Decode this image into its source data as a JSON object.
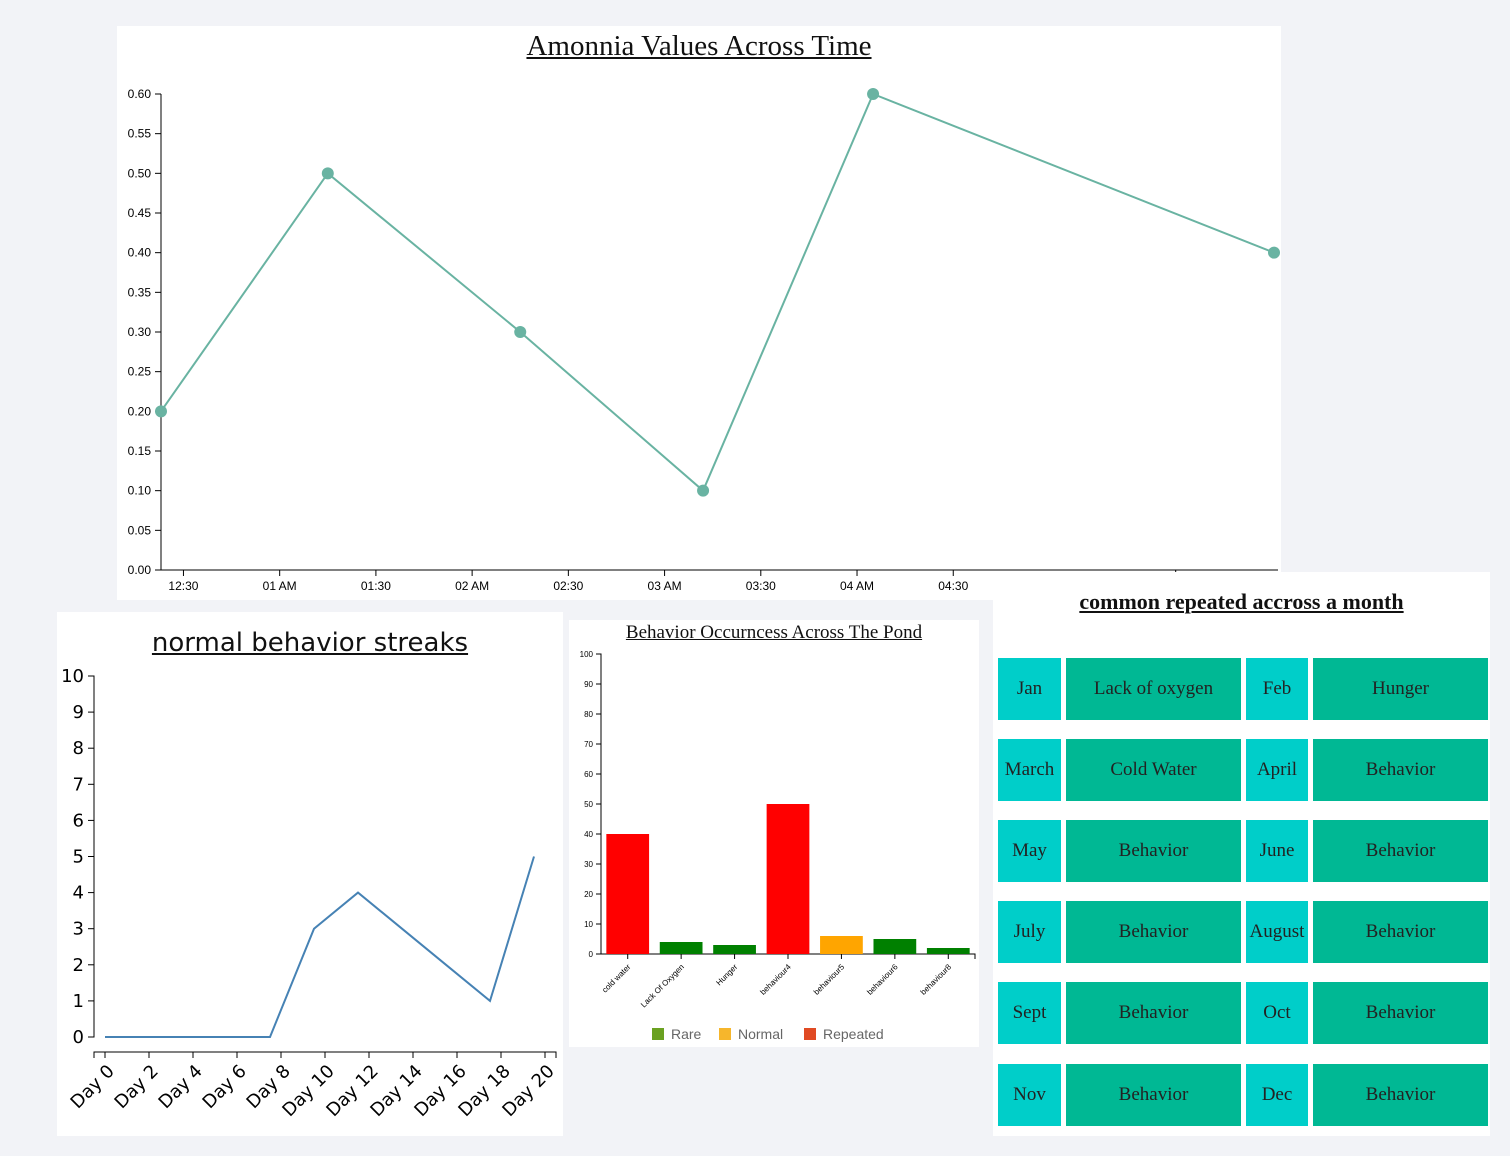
{
  "colors": {
    "page_bg": "#f2f3f7",
    "ammonia_line": "#69b3a2",
    "streak_line": "#4682b4",
    "rare": "#008000",
    "normal": "#ffa500",
    "repeated": "#ff0000",
    "legend_rare": "#6aa121",
    "legend_normal": "#f6b62c",
    "legend_repeated": "#e04a23",
    "month_cell": "#00cec9",
    "behavior_cell": "#00b894"
  },
  "chart_data": [
    {
      "type": "line",
      "title": "Amonnia Values Across Time",
      "x_ticks": [
        "12:30",
        "01 AM",
        "01:30",
        "02 AM",
        "02:30",
        "03 AM",
        "03:30",
        "04 AM",
        "04:30"
      ],
      "x_ticks_minutes": [
        750,
        780,
        810,
        840,
        870,
        900,
        930,
        960,
        990
      ],
      "xlim_minutes": [
        743,
        1090
      ],
      "x_minutes": [
        743,
        795,
        855,
        912,
        965,
        1090
      ],
      "values": [
        0.2,
        0.5,
        0.3,
        0.1,
        0.6,
        0.4
      ],
      "ylim": [
        0,
        0.6
      ],
      "y_ticks": [
        "0.00",
        "0.05",
        "0.10",
        "0.15",
        "0.20",
        "0.25",
        "0.30",
        "0.35",
        "0.40",
        "0.45",
        "0.50",
        "0.55",
        "0.60"
      ],
      "grid": false,
      "markers": true
    },
    {
      "type": "line",
      "title": "normal behavior streaks",
      "categories": [
        "Day 0",
        "Day 2",
        "Day 4",
        "Day 6",
        "Day 8",
        "Day 10",
        "Day 12",
        "Day 14",
        "Day 16",
        "Day 18",
        "Day 20"
      ],
      "x": [
        0,
        2,
        4,
        6,
        7.5,
        9.5,
        11.5,
        13.5,
        15.5,
        17.5,
        19.5
      ],
      "values": [
        0,
        0,
        0,
        0,
        0,
        3,
        4,
        3,
        2,
        1,
        5
      ],
      "xlim": [
        -0.5,
        20.5
      ],
      "ylim": [
        0,
        10
      ],
      "y_ticks": [
        "0",
        "1",
        "2",
        "3",
        "4",
        "5",
        "6",
        "7",
        "8",
        "9",
        "10"
      ],
      "grid": false
    },
    {
      "type": "bar",
      "title": "Behavior Occurncess Across The Pond",
      "categories": [
        "cold water",
        "Lack Of Oxygen",
        "Hunger",
        "behaviour4",
        "behaviour5",
        "behaviour6",
        "behaviour8"
      ],
      "values": [
        40,
        4,
        3,
        50,
        6,
        5,
        2
      ],
      "levels": [
        "Repeated",
        "Rare",
        "Rare",
        "Repeated",
        "Normal",
        "Rare",
        "Rare"
      ],
      "ylim": [
        0,
        100
      ],
      "y_ticks": [
        "0",
        "10",
        "20",
        "30",
        "40",
        "50",
        "60",
        "70",
        "80",
        "90",
        "100"
      ],
      "legend": [
        "Rare",
        "Normal",
        "Repeated"
      ],
      "legend_position": "bottom",
      "grid": false
    },
    {
      "type": "table",
      "title": "common repeated accross a month",
      "rows": [
        [
          {
            "month": "Jan",
            "behavior": "Lack of oxygen"
          },
          {
            "month": "Feb",
            "behavior": "Hunger"
          }
        ],
        [
          {
            "month": "March",
            "behavior": "Cold Water"
          },
          {
            "month": "April",
            "behavior": "Behavior"
          }
        ],
        [
          {
            "month": "May",
            "behavior": "Behavior"
          },
          {
            "month": "June",
            "behavior": "Behavior"
          }
        ],
        [
          {
            "month": "July",
            "behavior": "Behavior"
          },
          {
            "month": "August",
            "behavior": "Behavior"
          }
        ],
        [
          {
            "month": "Sept",
            "behavior": "Behavior"
          },
          {
            "month": "Oct",
            "behavior": "Behavior"
          }
        ],
        [
          {
            "month": "Nov",
            "behavior": "Behavior"
          },
          {
            "month": "Dec",
            "behavior": "Behavior"
          }
        ]
      ]
    }
  ]
}
